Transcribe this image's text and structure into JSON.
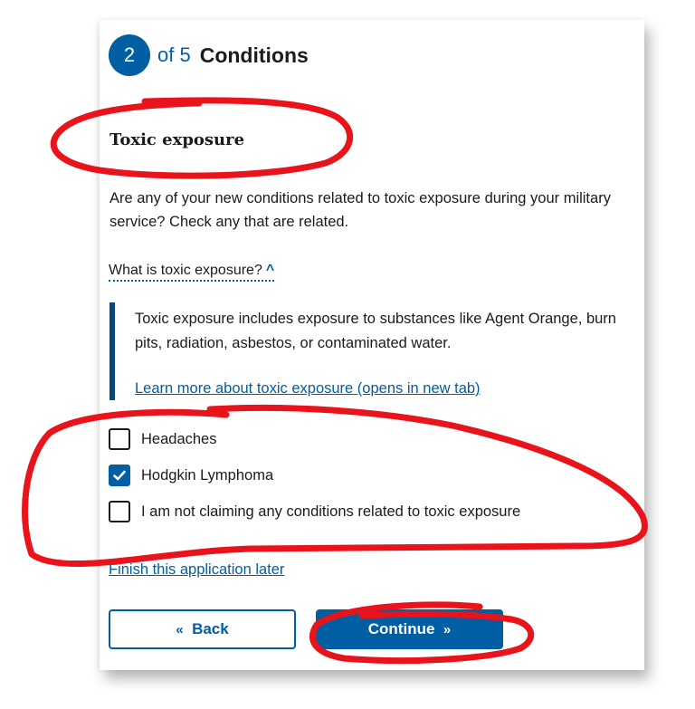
{
  "step": {
    "number": "2",
    "of_text": "of 5",
    "title": "Conditions"
  },
  "section_title": "Toxic exposure",
  "question": "Are any of your new conditions related to toxic exposure during your military service? Check any that are related.",
  "expander": {
    "label": "What is toxic exposure?",
    "text": "Toxic exposure includes exposure to substances like Agent Orange, burn pits, radiation, asbestos, or contaminated water.",
    "link": "Learn more about toxic exposure (opens in new tab)"
  },
  "options": [
    {
      "label": "Headaches",
      "checked": false
    },
    {
      "label": "Hodgkin Lymphoma",
      "checked": true
    },
    {
      "label": "I am not claiming any conditions related to toxic exposure",
      "checked": false
    }
  ],
  "finish_link": "Finish this application later",
  "buttons": {
    "back": "Back",
    "continue": "Continue"
  },
  "colors": {
    "primary": "#005ea2",
    "annotation": "#e8131b"
  }
}
